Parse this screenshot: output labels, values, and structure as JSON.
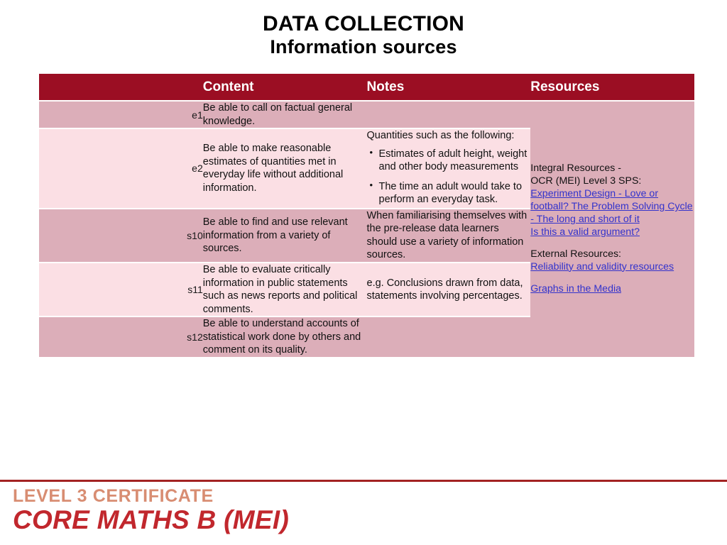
{
  "slide": {
    "title_main": "DATA COLLECTION",
    "title_sub": "Information sources"
  },
  "table": {
    "headers": {
      "code": "",
      "content": "Content",
      "notes": "Notes",
      "resources": "Resources"
    },
    "rows": [
      {
        "code": "e1",
        "content": "Be able to call on factual general knowledge.",
        "notes_intro": "",
        "notes_bullets": []
      },
      {
        "code": "e2",
        "content": "Be able to make reasonable estimates of quantities met in everyday life without additional information.",
        "notes_intro": "Quantities such as the following:",
        "notes_bullets": [
          "Estimates of adult height, weight and other body measurements",
          "The time an adult would take to perform an everyday task."
        ]
      },
      {
        "code": "s10",
        "content": "Be able to find and use relevant information from a variety of sources.",
        "notes_intro": "When familiarising themselves with the pre-release data learners should use a variety of information sources.",
        "notes_bullets": []
      },
      {
        "code": "s11",
        "content": "Be able to evaluate critically information in public statements such as news reports and political comments.",
        "notes_intro": "e.g. Conclusions drawn from data, statements involving percentages.",
        "notes_bullets": []
      },
      {
        "code": "s12",
        "content": "Be able to understand accounts of statistical work done by others and comment on its quality.",
        "notes_intro": "",
        "notes_bullets": []
      }
    ],
    "resources": {
      "integral_heading_line1": "Integral Resources -",
      "integral_heading_line2": "OCR (MEI) Level 3 SPS:",
      "integral_links": [
        "Experiment Design - Love or football?  The Problem Solving Cycle - The long and short of it",
        "Is this a valid argument?"
      ],
      "external_heading": "External Resources:",
      "external_links": [
        "Reliability and validity resources"
      ],
      "extra_links": [
        "Graphs in the Media"
      ]
    }
  },
  "footer": {
    "logo_line1": "LEVEL 3 CERTIFICATE",
    "logo_line2": "CORE MATHS B (MEI)"
  },
  "colors": {
    "header_red": "#9B0E23",
    "row_dark": "#DCAEB9",
    "row_light": "#FBDFE4",
    "link_blue": "#3333CC",
    "footer_rule": "#A32323",
    "logo_salmon": "#D88D72",
    "logo_red": "#C1272D"
  }
}
